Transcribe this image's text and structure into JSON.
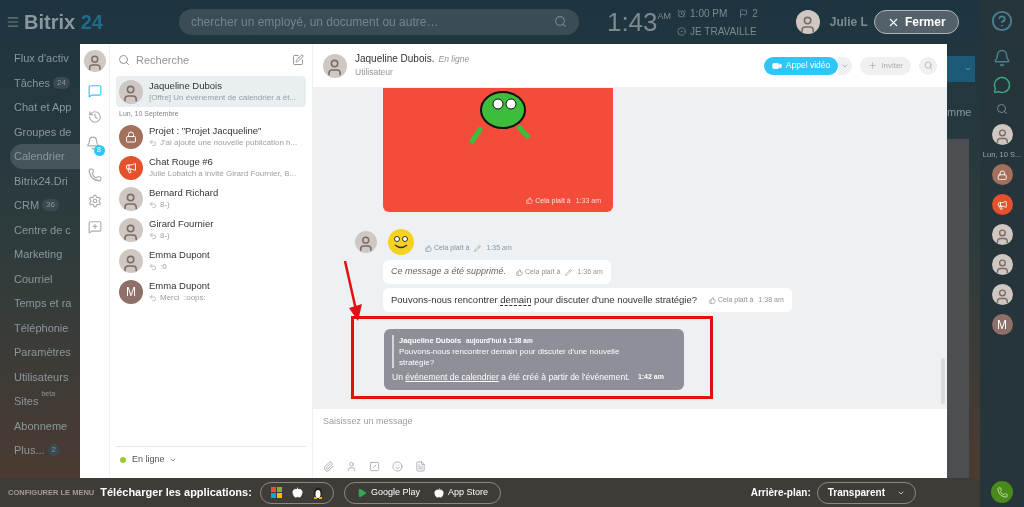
{
  "top_bar": {
    "logo": {
      "word": "Bitrix",
      "number": "24"
    },
    "search": {
      "placeholder": "chercher un employé, un document ou autre…"
    },
    "clock": {
      "time": "1:43",
      "period": "AM"
    },
    "alarm": "1:00 PM",
    "flags": "2",
    "work_status": "JE TRAVAILLE",
    "user_name": "Julie L",
    "close_button": "Fermer"
  },
  "left_menu": {
    "items": [
      {
        "label": "Flux d'activ",
        "selected": false
      },
      {
        "label": "Tâches",
        "count": "24",
        "selected": false
      },
      {
        "label": "Chat et App",
        "selected": false
      },
      {
        "label": "Groupes de",
        "selected": false
      },
      {
        "label": "Calendrier",
        "selected": true
      },
      {
        "label": "Bitrix24.Dri",
        "selected": false
      },
      {
        "label": "CRM",
        "count": "36",
        "selected": false
      },
      {
        "label": "Centre de c",
        "selected": false
      },
      {
        "label": "Marketing",
        "selected": false
      },
      {
        "label": "Courriel",
        "selected": false
      },
      {
        "label": "Temps et ra",
        "selected": false
      },
      {
        "label": "Téléphonie",
        "selected": false
      },
      {
        "label": "Paramètres",
        "selected": false
      },
      {
        "label": "Utilisateurs",
        "selected": false
      },
      {
        "label": "Sites",
        "tag": "beta",
        "selected": false
      },
      {
        "label": "Abonneme",
        "selected": false
      },
      {
        "label": "Plus...",
        "count": "2",
        "selected": false
      }
    ],
    "configure": "CONFIGURER LE MENU"
  },
  "messenger": {
    "rail": [
      {
        "kind": "chats",
        "selected": true
      },
      {
        "kind": "history",
        "selected": false
      },
      {
        "kind": "notifications",
        "badge": "8",
        "selected": false
      },
      {
        "kind": "phone",
        "selected": false
      },
      {
        "kind": "settings",
        "selected": false
      },
      {
        "kind": "new-chat",
        "selected": false
      }
    ],
    "chat_list": {
      "search": {
        "placeholder": "Recherche"
      },
      "entries": [
        {
          "kind": "chat",
          "avatar": {
            "kind": "photo"
          },
          "name": "Jaqueline Dubois",
          "preview": "[Offre] Un événement de calendrier a ét...",
          "replied": false,
          "selected": true
        },
        {
          "kind": "date",
          "label": "Lun, 10 Septembre"
        },
        {
          "kind": "chat",
          "avatar": {
            "kind": "lock"
          },
          "name": "Projet : \"Projet Jacqueline\"",
          "preview": "J'ai ajouté une nouvelle publication h...",
          "replied": true,
          "selected": false
        },
        {
          "kind": "chat",
          "avatar": {
            "kind": "megaphone"
          },
          "name": "Chat Rouge #6",
          "preview": "Julie Lobatch a invité Girard Fournier, B...",
          "replied": false,
          "selected": false
        },
        {
          "kind": "chat",
          "avatar": {
            "kind": "photo"
          },
          "name": "Bernard Richard",
          "preview": "8-)",
          "replied": true,
          "selected": false
        },
        {
          "kind": "chat",
          "avatar": {
            "kind": "photo"
          },
          "name": "Girard Fournier",
          "preview": "8-)",
          "replied": true,
          "selected": false
        },
        {
          "kind": "chat",
          "avatar": {
            "kind": "photo"
          },
          "name": "Emma Dupont",
          "preview": ":0",
          "replied": true,
          "selected": false
        },
        {
          "kind": "chat",
          "avatar": {
            "kind": "letter",
            "letter": "M"
          },
          "name": "Emma Dupont",
          "preview": "Merci  :oops:",
          "replied": true,
          "selected": false
        }
      ],
      "status": {
        "label": "En ligne",
        "color": "#9acb34"
      }
    },
    "chat": {
      "name": "Jaqueline Dubois.",
      "presence": "En ligne",
      "role": "Utilisateur",
      "video_button": "Appel vidéo",
      "invite_button": "Inviter",
      "messages": [
        {
          "kind": "sticker",
          "likes": "Cela plaît à",
          "time": "1:33 am",
          "edited": false
        },
        {
          "kind": "emoji",
          "likes": "Cela plaît à",
          "time": "1:35 am",
          "edited": true
        },
        {
          "kind": "deleted",
          "text": "Ce message a été supprimé.",
          "likes": "Cela plaît à",
          "time": "1:36 am",
          "edited": true
        },
        {
          "kind": "text",
          "parts": [
            {
              "text": "Pouvons-nous rencontrer "
            },
            {
              "text": "demain",
              "link": true
            },
            {
              "text": " pour discuter d'une nouvelle stratégie?"
            }
          ],
          "likes": "Cela plaît à",
          "time": "1:38 am",
          "edited": false
        },
        {
          "kind": "system",
          "highlighted": true,
          "quote": {
            "author": "Jaqueline Dubois",
            "time": "aujourd'hui à 1:38 am",
            "text": "Pouvons-nous rencontrer demain pour discuter d'une nouvelle stratégie?"
          },
          "parts": [
            {
              "text": "Un "
            },
            {
              "text": "événement de calendrier",
              "link": true
            },
            {
              "text": " a été créé à partir de l'événement."
            }
          ],
          "time": "1:42 am"
        }
      ],
      "input": {
        "placeholder": "Saisissez un message"
      }
    }
  },
  "page_fragment": "mme",
  "right_strip": [
    {
      "kind": "photo"
    },
    {
      "kind": "date",
      "label": "Lun, 10 S..."
    },
    {
      "kind": "lock"
    },
    {
      "kind": "megaphone"
    },
    {
      "kind": "photo"
    },
    {
      "kind": "photo"
    },
    {
      "kind": "photo"
    },
    {
      "kind": "letter",
      "letter": "M"
    }
  ],
  "bottom_bar": {
    "download_label": "Télécharger les applications:",
    "stores": [
      "Google Play",
      "App Store"
    ],
    "background_label": "Arrière-plan:",
    "background_value": "Transparent"
  }
}
